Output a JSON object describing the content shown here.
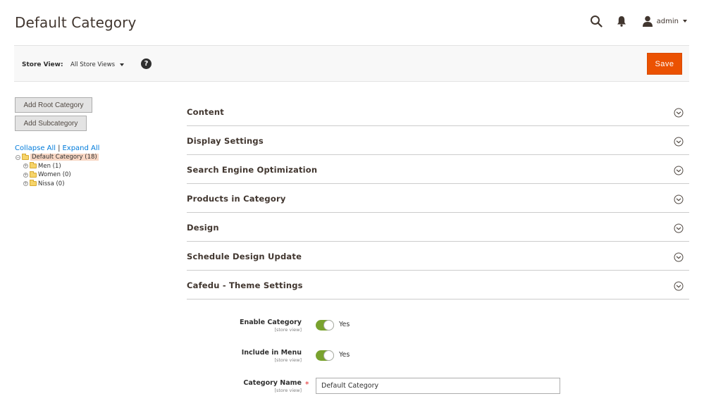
{
  "header": {
    "title": "Default Category",
    "admin_name": "admin"
  },
  "store_bar": {
    "label": "Store View:",
    "selected": "All Store Views",
    "help": "?",
    "save_label": "Save"
  },
  "tree": {
    "add_root_label": "Add Root Category",
    "add_sub_label": "Add Subcategory",
    "collapse_all": "Collapse All",
    "separator": "|",
    "expand_all": "Expand All",
    "root": "Default Category (18)",
    "children": [
      "Men (1)",
      "Women (0)",
      "Nissa (0)"
    ]
  },
  "sections": [
    "Content",
    "Display Settings",
    "Search Engine Optimization",
    "Products in Category",
    "Design",
    "Schedule Design Update",
    "Cafedu - Theme Settings"
  ],
  "form": {
    "enable_category": {
      "label": "Enable Category",
      "scope": "[store view]",
      "value": "Yes"
    },
    "include_in_menu": {
      "label": "Include in Menu",
      "scope": "[store view]",
      "value": "Yes"
    },
    "category_name": {
      "label": "Category Name",
      "scope": "[store view]",
      "required": "*",
      "value": "Default Category"
    }
  },
  "colors": {
    "accent": "#eb5202",
    "toggle_on": "#79a22e",
    "link": "#007bdb"
  }
}
